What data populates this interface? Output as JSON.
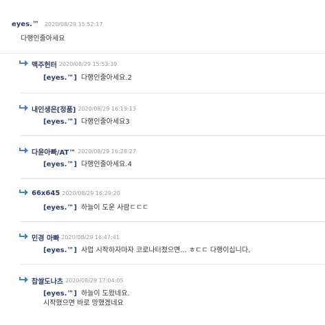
{
  "root": {
    "author": "eyes.™",
    "timestamp": "2020/08/29 15:52:17",
    "body": "다행인줄아세요"
  },
  "replies": [
    {
      "author": "맥주헌터",
      "timestamp": "2020/08/29 15:53:39",
      "mention": "[eyes.™]",
      "lines": [
        "다행인줄아세요.2"
      ]
    },
    {
      "author": "내인생은[정품]",
      "timestamp": "2020/08/29 16:19:13",
      "mention": "[eyes.™]",
      "lines": [
        "다행인줄아세요3"
      ]
    },
    {
      "author": "다윤아빠/AT™",
      "timestamp": "2020/08/29 16:28:27",
      "mention": "[eyes.™]",
      "lines": [
        "다행인줄아세요.4"
      ]
    },
    {
      "author": "66x645",
      "timestamp": "2020/08/29 16:29:20",
      "mention": "[eyes.™]",
      "lines": [
        "하늘이 도운 사람ㄷㄷㄷ"
      ]
    },
    {
      "author": "민경 아빠",
      "timestamp": "2020/08/29 16:47:41",
      "mention": "[eyes.™]",
      "lines": [
        "사업 시작하자마자 코로나터졌으면... ㅎㄷㄷ 다행이십니다."
      ]
    },
    {
      "author": "찹쌀도나츠",
      "timestamp": "2020/08/29 17:04:05",
      "mention": "[eyes.™]",
      "lines": [
        "하늘이 도왔네요.",
        "시작했으면 바로 망했겠네요"
      ]
    }
  ],
  "icons": {
    "reply": "reply-arrow-icon"
  },
  "colors": {
    "author": "#2a3c6a",
    "timestamp": "#999999",
    "reply_arrow": "#4a7fc1",
    "divider": "#e2e2e2"
  }
}
